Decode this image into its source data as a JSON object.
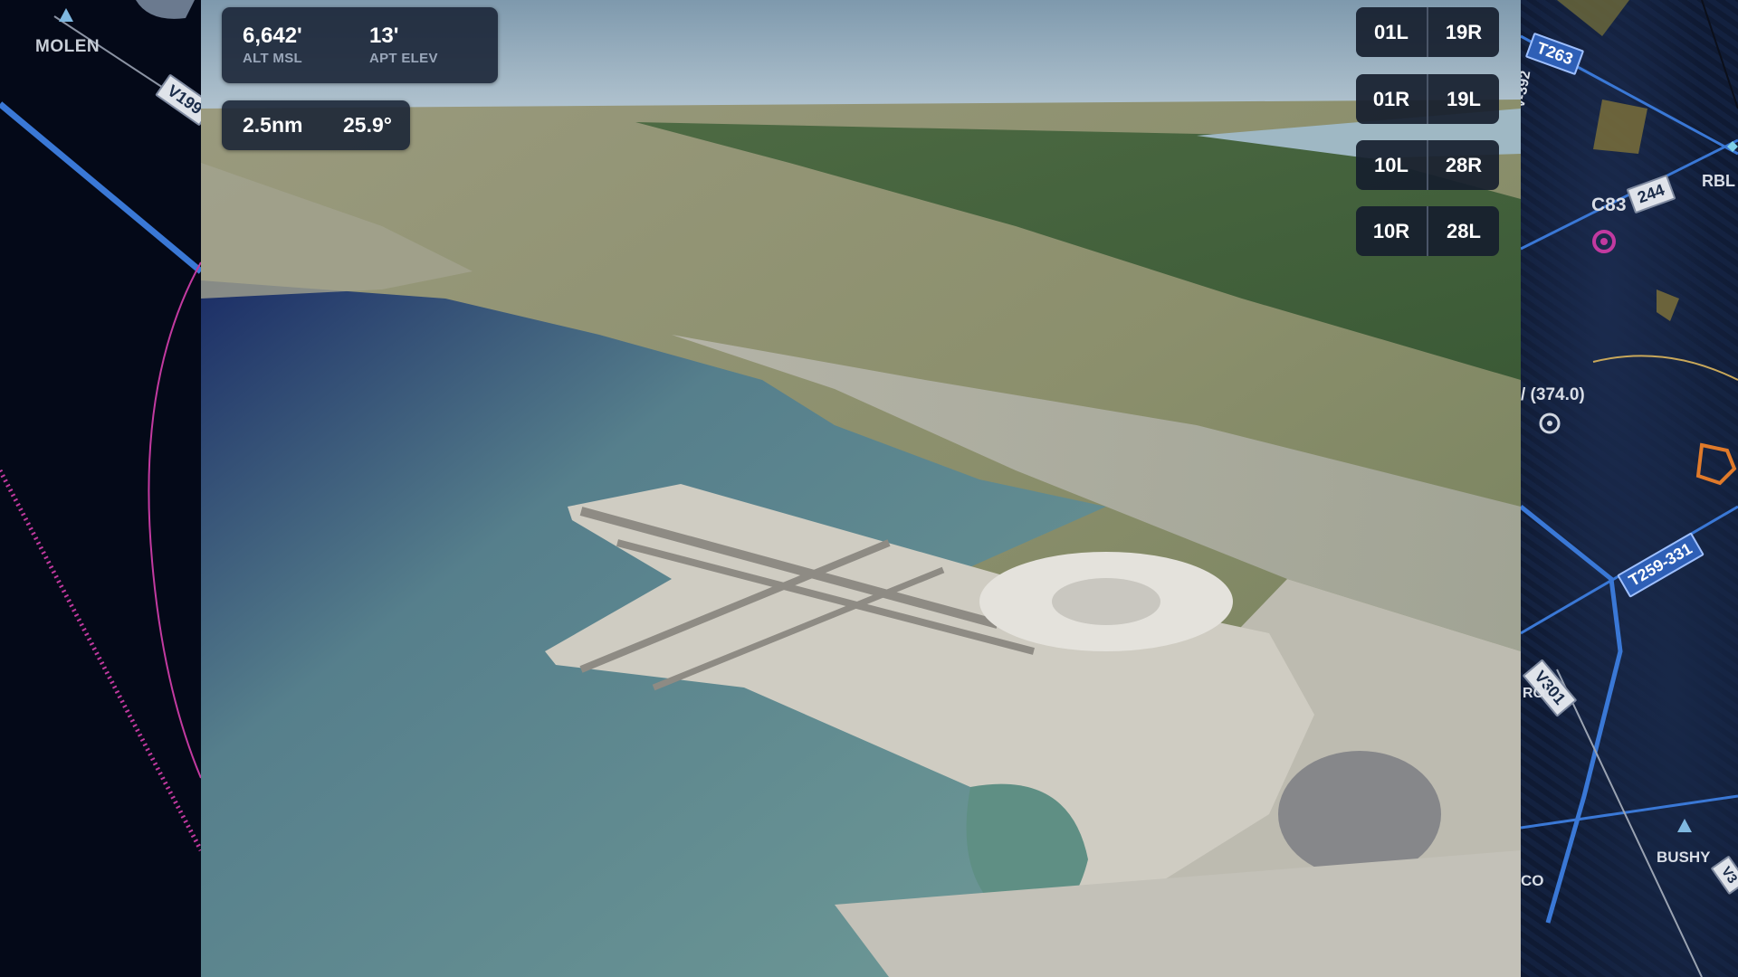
{
  "left_chart": {
    "waypoint_molen": "MOLEN",
    "airway_v199": "V199"
  },
  "altitude_panel": {
    "alt_value": "6,642'",
    "alt_label": "ALT MSL",
    "elev_value": "13'",
    "elev_label": "APT ELEV"
  },
  "distance_panel": {
    "distance": "2.5nm",
    "angle": "25.9°"
  },
  "runways": [
    {
      "a": "01L",
      "b": "19R"
    },
    {
      "a": "01R",
      "b": "19L"
    },
    {
      "a": "10L",
      "b": "28R"
    },
    {
      "a": "10R",
      "b": "28L"
    }
  ],
  "right_chart": {
    "airway_t263": "T263",
    "airway_v392": "V-392",
    "airway_244": "244",
    "airport_c83": "C83",
    "rbl": "RBL",
    "navaid_freq": "/ (374.0)",
    "airway_t259": "T259-331",
    "airway_v301": "V301",
    "rcl": "RCL",
    "waypoint_bushy": "BUSHY",
    "co": "CO",
    "airway_v3": "V3"
  },
  "colors": {
    "airway_blue": "#3a78d6",
    "magenta": "#c23aa0",
    "overlay_bg": "#182234",
    "water": "#5f8a93"
  }
}
